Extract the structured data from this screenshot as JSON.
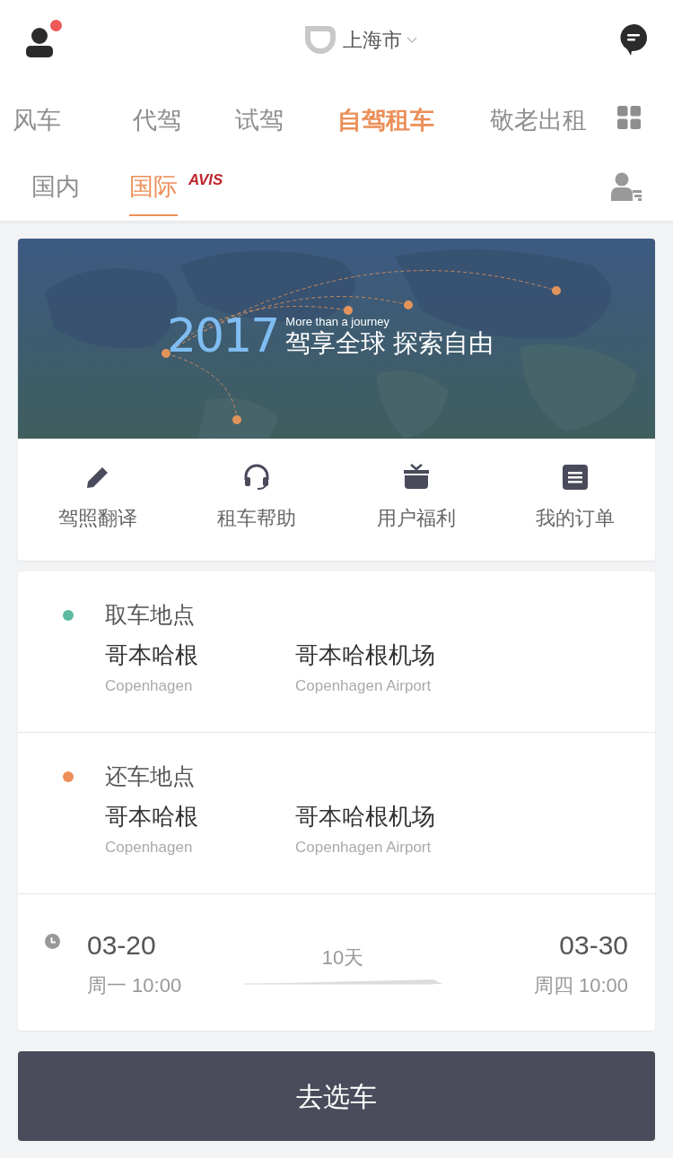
{
  "header": {
    "city": "上海市",
    "has_notification": true
  },
  "service_tabs": [
    {
      "label": "风车",
      "selected": false
    },
    {
      "label": "代驾",
      "selected": false
    },
    {
      "label": "试驾",
      "selected": false
    },
    {
      "label": "自驾租车",
      "selected": true
    },
    {
      "label": "敬老出租",
      "selected": false
    }
  ],
  "sub_tabs": [
    {
      "label": "国内",
      "selected": false
    },
    {
      "label": "国际",
      "selected": true,
      "badge": "AVIS"
    }
  ],
  "banner": {
    "kind": "picture",
    "year": "2017",
    "tagline": "More than a journey",
    "slogan": "驾享全球 探索自由"
  },
  "shortcuts": [
    {
      "kind": "pencil",
      "label": "驾照翻译"
    },
    {
      "kind": "headset",
      "label": "租车帮助"
    },
    {
      "kind": "gift",
      "label": "用户福利"
    },
    {
      "kind": "order",
      "label": "我的订单"
    }
  ],
  "locations": [
    {
      "title": "取车地点",
      "color": "#5bb9a0",
      "city": "哥本哈根",
      "city_en": "Copenhagen",
      "place": "哥本哈根机场",
      "place_en": "Copenhagen Airport"
    },
    {
      "title": "还车地点",
      "color": "#ec8f58",
      "city": "哥本哈根",
      "city_en": "Copenhagen",
      "place": "哥本哈根机场",
      "place_en": "Copenhagen Airport"
    }
  ],
  "dates": {
    "start_date": "03-20",
    "start_time": "周一 10:00",
    "duration": "10天",
    "end_date": "03-30",
    "end_time": "周四 10:00"
  },
  "submit_button": "去选车"
}
